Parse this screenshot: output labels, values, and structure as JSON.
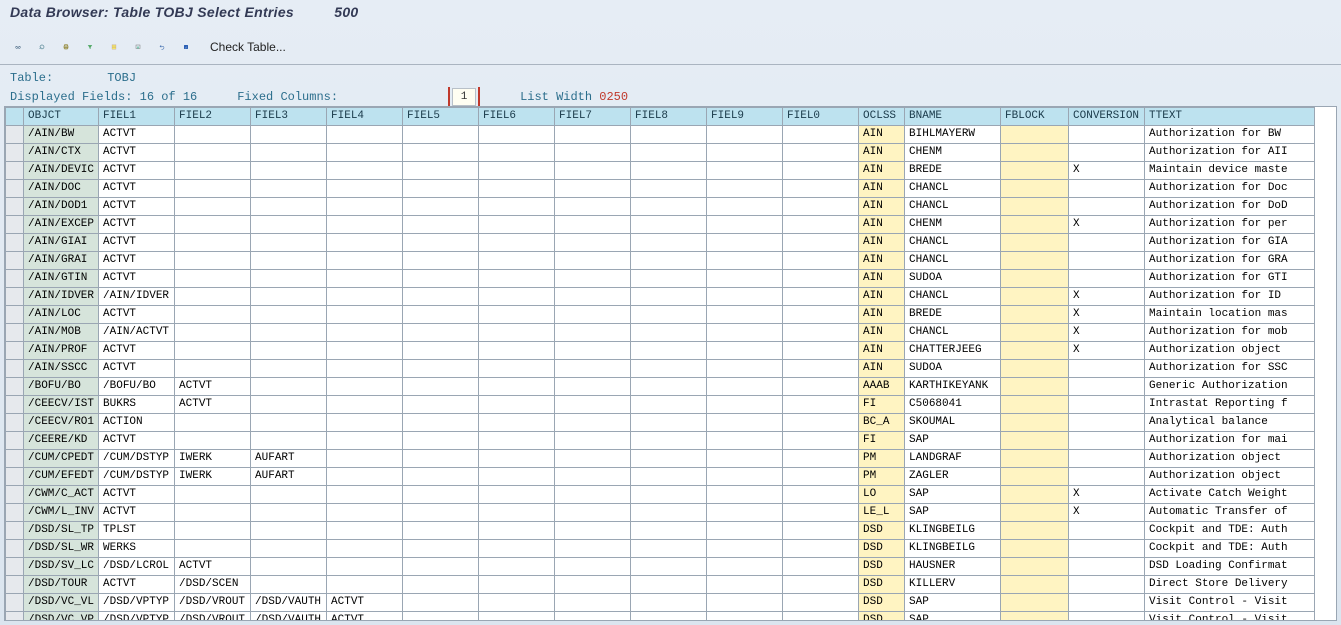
{
  "title": {
    "prefix": "Data Browser: Table TOBJ Select Entries",
    "count": "500"
  },
  "toolbar": {
    "check_table": "Check Table..."
  },
  "info": {
    "table_label": "Table:",
    "table_name": "TOBJ",
    "displayed_label": "Displayed Fields:",
    "displayed_val": "16 of  16",
    "fixed_label": "Fixed Columns:",
    "fixed_val": "1",
    "listw_label": "List Width",
    "listw_val": "0250"
  },
  "columns": [
    "",
    "OBJCT",
    "FIEL1",
    "FIEL2",
    "FIEL3",
    "FIEL4",
    "FIEL5",
    "FIEL6",
    "FIEL7",
    "FIEL8",
    "FIEL9",
    "FIEL0",
    "OCLSS",
    "BNAME",
    "FBLOCK",
    "CONVERSION",
    "TTEXT"
  ],
  "chart_data": {
    "type": "table",
    "columns": [
      "OBJCT",
      "FIEL1",
      "FIEL2",
      "FIEL3",
      "FIEL4",
      "FIEL5",
      "FIEL6",
      "FIEL7",
      "FIEL8",
      "FIEL9",
      "FIEL0",
      "OCLSS",
      "BNAME",
      "FBLOCK",
      "CONVERSION",
      "TTEXT"
    ],
    "rows": [
      {
        "OBJCT": "/AIN/BW",
        "FIEL1": "ACTVT",
        "OCLSS": "AIN",
        "BNAME": "BIHLMAYERW",
        "TTEXT": "Authorization for BW"
      },
      {
        "OBJCT": "/AIN/CTX",
        "FIEL1": "ACTVT",
        "OCLSS": "AIN",
        "BNAME": "CHENM",
        "TTEXT": "Authorization for AII"
      },
      {
        "OBJCT": "/AIN/DEVIC",
        "FIEL1": "ACTVT",
        "OCLSS": "AIN",
        "BNAME": "BREDE",
        "CONVERSION": "X",
        "TTEXT": "Maintain device maste"
      },
      {
        "OBJCT": "/AIN/DOC",
        "FIEL1": "ACTVT",
        "OCLSS": "AIN",
        "BNAME": "CHANCL",
        "TTEXT": "Authorization for Doc"
      },
      {
        "OBJCT": "/AIN/DOD1",
        "FIEL1": "ACTVT",
        "OCLSS": "AIN",
        "BNAME": "CHANCL",
        "TTEXT": "Authorization for DoD"
      },
      {
        "OBJCT": "/AIN/EXCEP",
        "FIEL1": "ACTVT",
        "OCLSS": "AIN",
        "BNAME": "CHENM",
        "CONVERSION": "X",
        "TTEXT": "Authorization for per"
      },
      {
        "OBJCT": "/AIN/GIAI",
        "FIEL1": "ACTVT",
        "OCLSS": "AIN",
        "BNAME": "CHANCL",
        "TTEXT": "Authorization for GIA"
      },
      {
        "OBJCT": "/AIN/GRAI",
        "FIEL1": "ACTVT",
        "OCLSS": "AIN",
        "BNAME": "CHANCL",
        "TTEXT": "Authorization for GRA"
      },
      {
        "OBJCT": "/AIN/GTIN",
        "FIEL1": "ACTVT",
        "OCLSS": "AIN",
        "BNAME": "SUDOA",
        "TTEXT": "Authorization for GTI"
      },
      {
        "OBJCT": "/AIN/IDVER",
        "FIEL1": "/AIN/IDVER",
        "OCLSS": "AIN",
        "BNAME": "CHANCL",
        "CONVERSION": "X",
        "TTEXT": "Authorization for ID"
      },
      {
        "OBJCT": "/AIN/LOC",
        "FIEL1": "ACTVT",
        "OCLSS": "AIN",
        "BNAME": "BREDE",
        "CONVERSION": "X",
        "TTEXT": "Maintain location mas"
      },
      {
        "OBJCT": "/AIN/MOB",
        "FIEL1": "/AIN/ACTVT",
        "OCLSS": "AIN",
        "BNAME": "CHANCL",
        "CONVERSION": "X",
        "TTEXT": "Authorization for mob"
      },
      {
        "OBJCT": "/AIN/PROF",
        "FIEL1": "ACTVT",
        "OCLSS": "AIN",
        "BNAME": "CHATTERJEEG",
        "CONVERSION": "X",
        "TTEXT": "Authorization object"
      },
      {
        "OBJCT": "/AIN/SSCC",
        "FIEL1": "ACTVT",
        "OCLSS": "AIN",
        "BNAME": "SUDOA",
        "TTEXT": "Authorization for SSC"
      },
      {
        "OBJCT": "/BOFU/BO",
        "FIEL1": "/BOFU/BO",
        "FIEL2": "ACTVT",
        "OCLSS": "AAAB",
        "BNAME": "KARTHIKEYANK",
        "TTEXT": "Generic Authorization"
      },
      {
        "OBJCT": "/CEECV/IST",
        "FIEL1": "BUKRS",
        "FIEL2": "ACTVT",
        "OCLSS": "FI",
        "BNAME": "C5068041",
        "TTEXT": "Intrastat Reporting f"
      },
      {
        "OBJCT": "/CEECV/RO1",
        "FIEL1": "ACTION",
        "OCLSS": "BC_A",
        "BNAME": "SKOUMAL",
        "TTEXT": "Analytical balance"
      },
      {
        "OBJCT": "/CEERE/KD",
        "FIEL1": "ACTVT",
        "OCLSS": "FI",
        "BNAME": "SAP",
        "TTEXT": "Authorization for mai"
      },
      {
        "OBJCT": "/CUM/CPEDT",
        "FIEL1": "/CUM/DSTYP",
        "FIEL2": "IWERK",
        "FIEL3": "AUFART",
        "OCLSS": "PM",
        "BNAME": "LANDGRAF",
        "TTEXT": "Authorization object"
      },
      {
        "OBJCT": "/CUM/EFEDT",
        "FIEL1": "/CUM/DSTYP",
        "FIEL2": "IWERK",
        "FIEL3": "AUFART",
        "OCLSS": "PM",
        "BNAME": "ZAGLER",
        "TTEXT": "Authorization object"
      },
      {
        "OBJCT": "/CWM/C_ACT",
        "FIEL1": "ACTVT",
        "OCLSS": "LO",
        "BNAME": "SAP",
        "CONVERSION": "X",
        "TTEXT": "Activate Catch Weight"
      },
      {
        "OBJCT": "/CWM/L_INV",
        "FIEL1": "ACTVT",
        "OCLSS": "LE_L",
        "BNAME": "SAP",
        "CONVERSION": "X",
        "TTEXT": "Automatic Transfer of"
      },
      {
        "OBJCT": "/DSD/SL_TP",
        "FIEL1": "TPLST",
        "OCLSS": "DSD",
        "BNAME": "KLINGBEILG",
        "TTEXT": "Cockpit and TDE: Auth"
      },
      {
        "OBJCT": "/DSD/SL_WR",
        "FIEL1": "WERKS",
        "OCLSS": "DSD",
        "BNAME": "KLINGBEILG",
        "TTEXT": "Cockpit and TDE: Auth"
      },
      {
        "OBJCT": "/DSD/SV_LC",
        "FIEL1": "/DSD/LCROL",
        "FIEL2": "ACTVT",
        "OCLSS": "DSD",
        "BNAME": "HAUSNER",
        "TTEXT": "DSD Loading Confirmat"
      },
      {
        "OBJCT": "/DSD/TOUR",
        "FIEL1": "ACTVT",
        "FIEL2": "/DSD/SCEN",
        "OCLSS": "DSD",
        "BNAME": "KILLERV",
        "TTEXT": "Direct Store Delivery"
      },
      {
        "OBJCT": "/DSD/VC_VL",
        "FIEL1": "/DSD/VPTYP",
        "FIEL2": "/DSD/VROUT",
        "FIEL3": "/DSD/VAUTH",
        "FIEL4": "ACTVT",
        "OCLSS": "DSD",
        "BNAME": "SAP",
        "TTEXT": "Visit Control - Visit"
      },
      {
        "OBJCT": "/DSD/VC_VP",
        "FIEL1": "/DSD/VPTYP",
        "FIEL2": "/DSD/VROUT",
        "FIEL3": "/DSD/VAUTH",
        "FIEL4": "ACTVT",
        "OCLSS": "DSD",
        "BNAME": "SAP",
        "TTEXT": "Visit Control - Visit"
      }
    ]
  }
}
